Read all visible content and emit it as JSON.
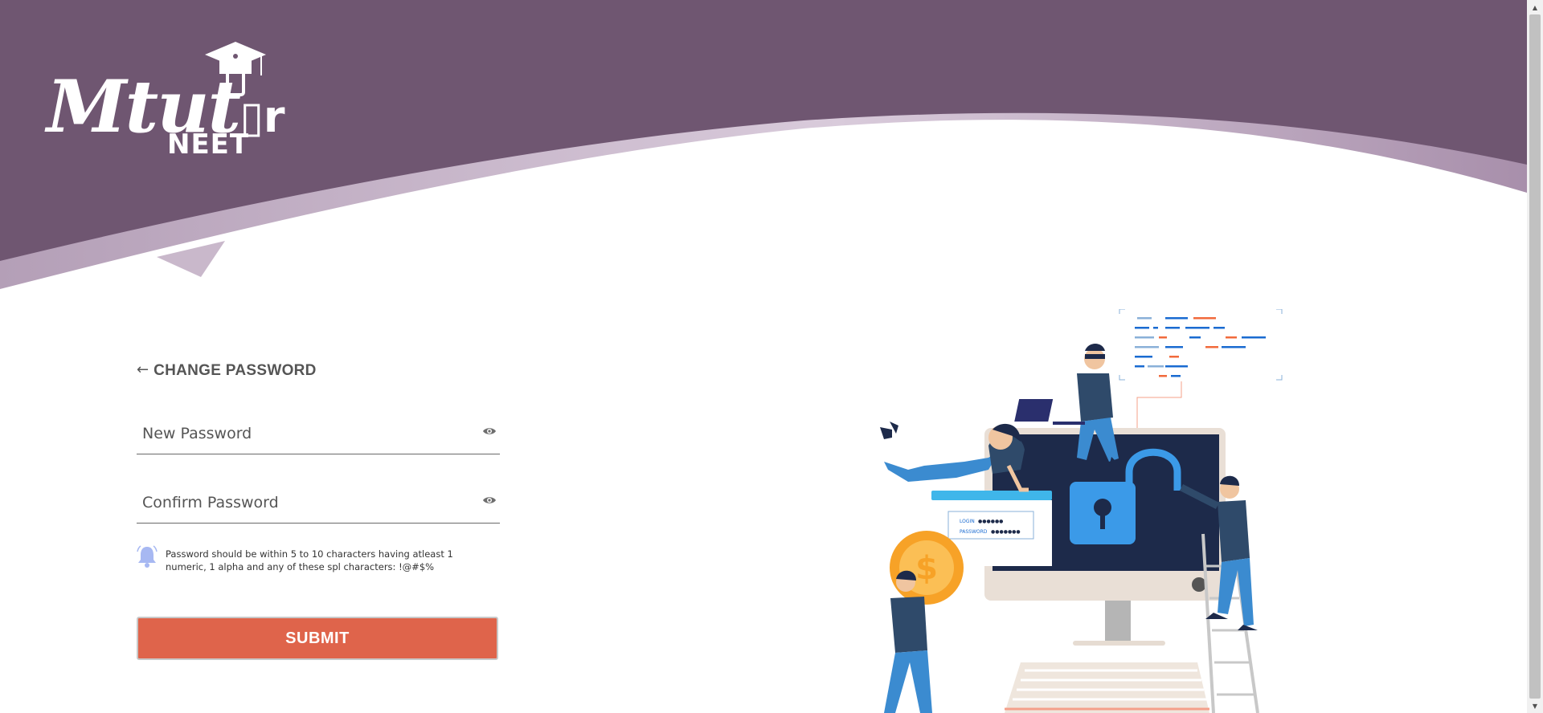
{
  "brand": {
    "logo_main": "Mtut",
    "logo_tail": "r",
    "logo_sub": "NEET",
    "colors": {
      "header": "#6f5671",
      "wave_light": "#bda8bf",
      "accent": "#df644b",
      "illustration_blue": "#3b9ae8"
    }
  },
  "page": {
    "back_icon": "arrow-left-icon",
    "title": "CHANGE PASSWORD"
  },
  "form": {
    "new_password": {
      "placeholder": "New Password",
      "value": "",
      "icon": "eye-icon"
    },
    "confirm_password": {
      "placeholder": "Confirm Password",
      "value": "",
      "icon": "eye-icon"
    },
    "hint_icon": "bell-icon",
    "hint": "Password should be within 5 to 10 characters having atleast 1 numeric, 1 alpha and any of these spl characters: !@#$%",
    "submit_label": "SUBMIT"
  },
  "illustration": {
    "login_label": "LOGIN",
    "login_value": "●●●●●●",
    "password_label": "PASSWORD",
    "password_value": "●●●●●●●",
    "coin_symbol": "$"
  },
  "scrollbar": {
    "up_icon": "▲",
    "down_icon": "▼"
  }
}
